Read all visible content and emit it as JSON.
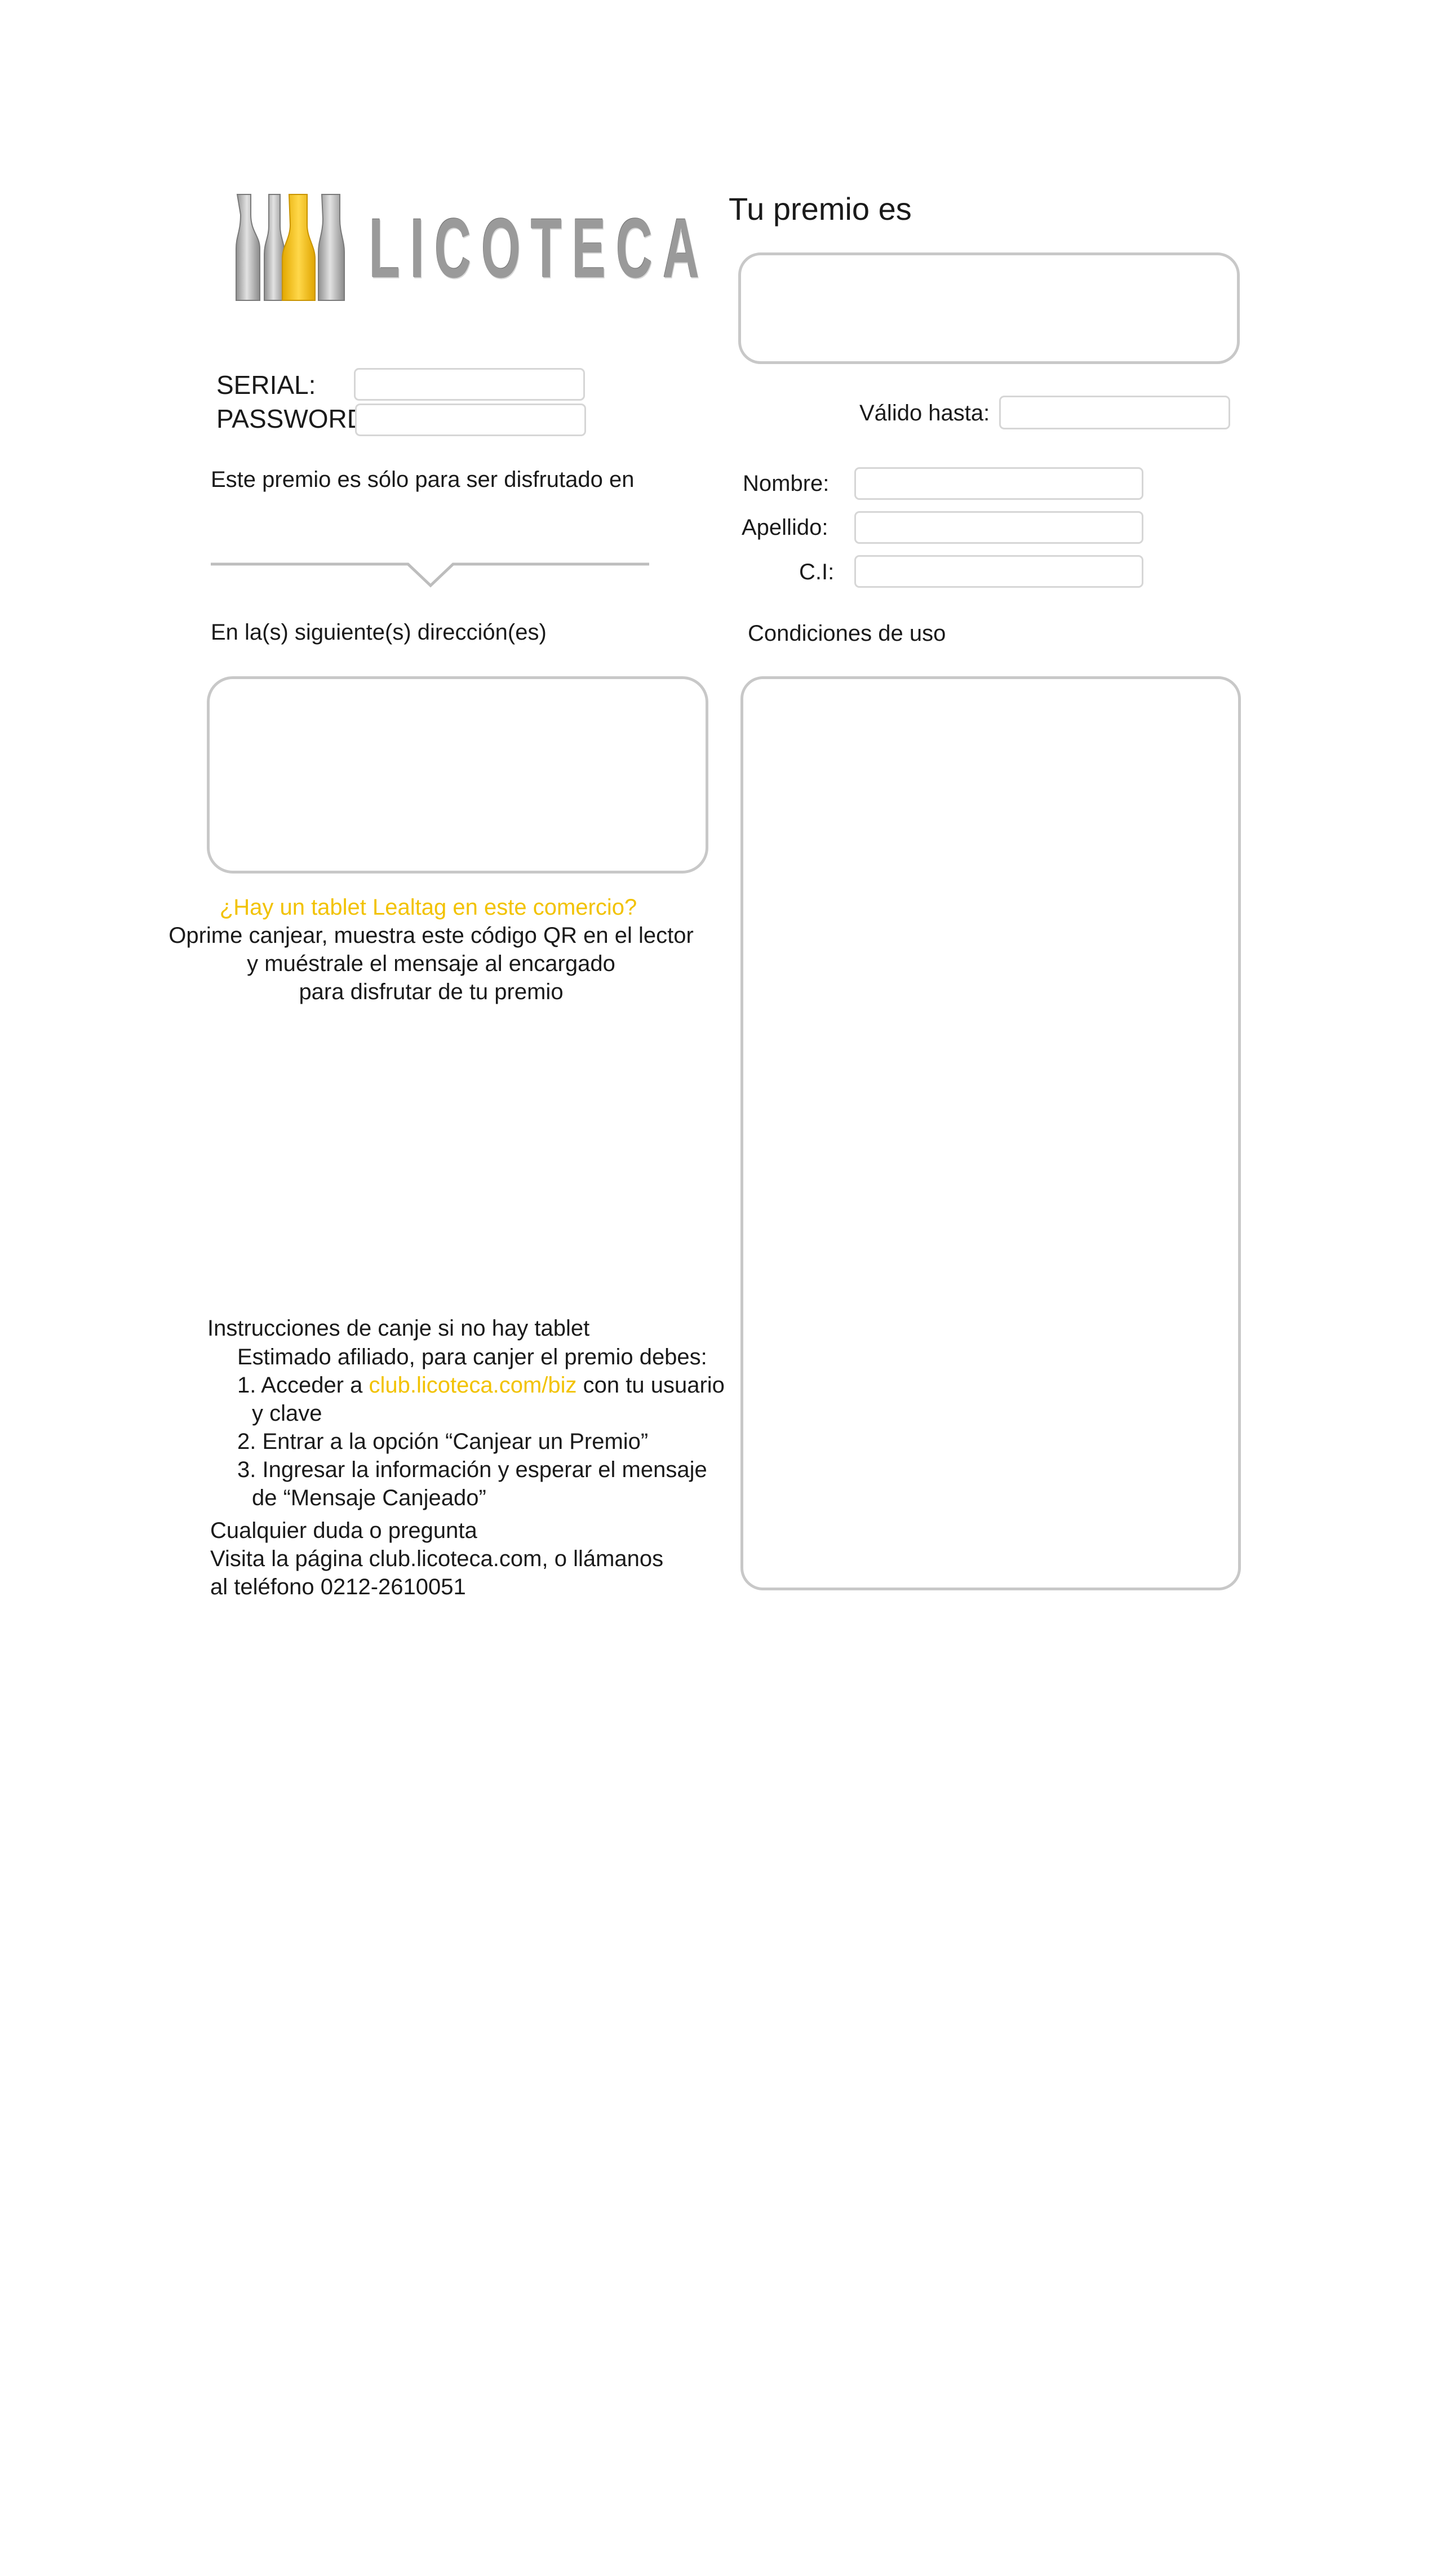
{
  "brand": {
    "name": "LICOTECA",
    "accent_color": "#F2C200",
    "logo_icon": "three-bottles-logo-icon"
  },
  "credentials": {
    "serial_label": "SERIAL:",
    "serial_value": "",
    "password_label": "PASSWORD:",
    "password_value": ""
  },
  "prize": {
    "title": "Tu premio es",
    "value": "",
    "valid_until_label": "Válido hasta:",
    "valid_until_value": ""
  },
  "person": {
    "nombre_label": "Nombre:",
    "nombre_value": "",
    "apellido_label": "Apellido:",
    "apellido_value": "",
    "ci_label": "C.I:",
    "ci_value": ""
  },
  "venue": {
    "intro": "Este premio es sólo para ser disfrutado en",
    "venue_name": "",
    "addresses_label": "En la(s) siguiente(s) dirección(es)",
    "addresses_value": ""
  },
  "conditions": {
    "label": "Condiciones de uso",
    "text": ""
  },
  "tablet": {
    "question": "¿Hay un tablet Lealtag en este comercio?",
    "line1": "Oprime canjear, muestra este código QR en el lector",
    "line2": "y muéstrale el mensaje al encargado",
    "line3": "para disfrutar de tu premio"
  },
  "instructions": {
    "title": "Instrucciones de canje si no hay tablet",
    "intro": "Estimado afiliado, para canjer el premio debes:",
    "step1_prefix": "1. Acceder a ",
    "step1_link": "club.licoteca.com/biz",
    "step1_suffix": " con tu usuario",
    "step1_cont": "y clave",
    "step2": "2. Entrar a la opción “Canjear un Premio”",
    "step3": "3. Ingresar la información y esperar el mensaje",
    "step3_cont": "de “Mensaje Canjeado”"
  },
  "contact": {
    "line1": "Cualquier duda o pregunta",
    "line2": "Visita la página club.licoteca.com, o llámanos",
    "line3": "al teléfono 0212-2610051"
  }
}
